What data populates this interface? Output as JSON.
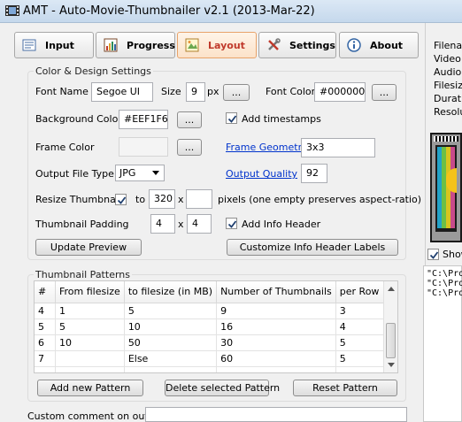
{
  "window": {
    "title": "AMT - Auto-Movie-Thumbnailer v2.1 (2013-Mar-22)",
    "icon": "film-icon"
  },
  "tabs": [
    {
      "label": "Input",
      "icon": "input-icon",
      "active": false
    },
    {
      "label": "Progress",
      "icon": "progress-icon",
      "active": false
    },
    {
      "label": "Layout",
      "icon": "layout-icon",
      "active": true
    },
    {
      "label": "Settings",
      "icon": "tools-icon",
      "active": false
    },
    {
      "label": "About",
      "icon": "info-icon",
      "active": false
    }
  ],
  "colors": {
    "active_tab_text": "#c0392b",
    "link": "#0033cc",
    "background": "#f0f0f0"
  },
  "design": {
    "group_title": "Color & Design Settings",
    "font_name_label": "Font Name",
    "font_name_value": "Segoe UI",
    "size_label": "Size",
    "size_value": "9",
    "size_unit": "px",
    "browse_label": "...",
    "font_color_label": "Font Color",
    "font_color_value": "#000000",
    "background_color_label": "Background Color",
    "background_color_value": "#EEF1F6",
    "add_timestamps_label": "Add timestamps",
    "add_timestamps_checked": true,
    "frame_color_label": "Frame Color",
    "frame_color_value": "",
    "frame_geometry_label": "Frame Geometry",
    "frame_geometry_value": "3x3",
    "output_file_type_label": "Output File Type",
    "output_file_type_value": "JPG",
    "output_quality_label": "Output Quality",
    "output_quality_value": "92",
    "resize_label": "Resize Thumbnails",
    "resize_checked": true,
    "resize_to": "to",
    "resize_width": "320",
    "resize_x": "x",
    "resize_height": "",
    "resize_hint": "pixels (one empty preserves aspect-ratio)",
    "padding_label": "Thumbnail Padding",
    "padding_x_value": "4",
    "padding_x": "x",
    "padding_y_value": "4",
    "add_info_header_label": "Add Info Header",
    "add_info_header_checked": true,
    "update_preview_label": "Update Preview",
    "customize_header_label": "Customize Info Header Labels"
  },
  "patterns": {
    "group_title": "Thumbnail Patterns",
    "columns": [
      "#",
      "From filesize",
      "to filesize (in MB)",
      "Number of Thumbnails",
      "per Row"
    ],
    "rows": [
      [
        "4",
        "1",
        "5",
        "9",
        "3"
      ],
      [
        "5",
        "5",
        "10",
        "16",
        "4"
      ],
      [
        "6",
        "10",
        "50",
        "30",
        "5"
      ],
      [
        "7",
        "",
        "Else",
        "60",
        "5"
      ]
    ],
    "add_label": "Add new Pattern",
    "delete_label": "Delete selected Pattern",
    "reset_label": "Reset Pattern"
  },
  "comment": {
    "label": "Custom comment on output",
    "value": ""
  },
  "right_panel": {
    "info_lines": [
      "Filena",
      "Video",
      "Audio",
      "Filesiz",
      "Durati",
      "Resolu"
    ],
    "show_label": "Show",
    "show_checked": true,
    "log_lines": [
      "\"C:\\Pro",
      "\"C:\\Pro",
      "\"C:\\Pro"
    ]
  }
}
